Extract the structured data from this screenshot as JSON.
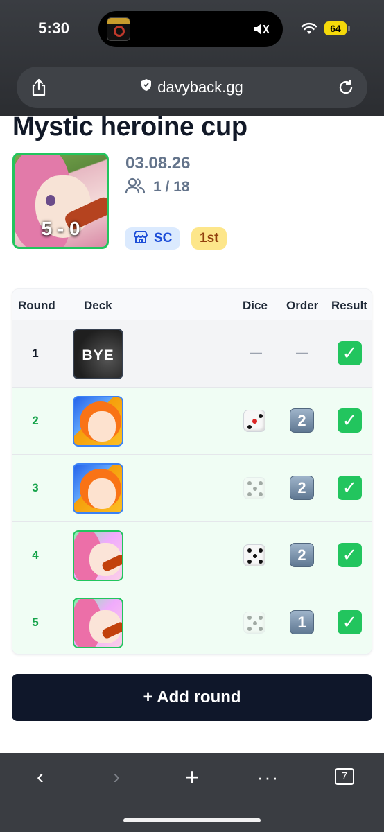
{
  "status_bar": {
    "time": "5:30",
    "battery": "64",
    "icons": [
      "mute-icon",
      "wifi-icon",
      "battery-icon"
    ]
  },
  "url_bar": {
    "domain": "davyback.gg",
    "icons": [
      "share-icon",
      "shield-icon",
      "reload-icon"
    ]
  },
  "event": {
    "title": "Mystic heroine cup",
    "record": "5 - 0",
    "date": "03.08.26",
    "placement_count": "1 / 18",
    "store_badge": "SC",
    "place_badge": "1st"
  },
  "table": {
    "headers": {
      "round": "Round",
      "deck": "Deck",
      "dice": "Dice",
      "order": "Order",
      "result": "Result"
    },
    "rows": [
      {
        "round": "1",
        "deck": "BYE",
        "dice": "—",
        "order": "—",
        "result": "✓"
      },
      {
        "round": "2",
        "deck": "nami",
        "dice": "won",
        "order": "2",
        "result": "✓"
      },
      {
        "round": "3",
        "deck": "nami",
        "dice": "lost",
        "order": "2",
        "result": "✓"
      },
      {
        "round": "4",
        "deck": "bonney",
        "dice": "won",
        "order": "2",
        "result": "✓"
      },
      {
        "round": "5",
        "deck": "bonney",
        "dice": "lost",
        "order": "1",
        "result": "✓"
      }
    ]
  },
  "add_round_label": "+ Add round",
  "toolbar": {
    "back": "‹",
    "forward": "›",
    "new_tab": "+",
    "more": "···",
    "tab_count": "7"
  },
  "colors": {
    "win_row": "#f0fdf4",
    "win_text": "#16a34a",
    "button_dark": "#0f172a",
    "result_green": "#22c55e"
  }
}
